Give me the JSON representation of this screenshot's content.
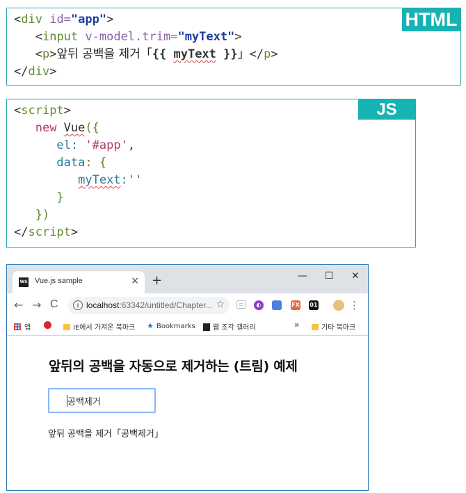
{
  "html_panel": {
    "badge": "HTML",
    "line1": {
      "open": "<",
      "tag": "div",
      "attr": " id=",
      "value": "\"app\"",
      "close": ">"
    },
    "line2": {
      "open": "<",
      "tag": "input",
      "attr": " v-model.trim=",
      "value": "\"myText\"",
      "close": ">"
    },
    "line3": {
      "open": "<",
      "tag": "p",
      "close": ">",
      "text_before": "앞뒤 공백을 제거「",
      "mustache_open": "{{ ",
      "var": "myText",
      "mustache_close": " }}",
      "text_after": "」",
      "end_open": "</",
      "end_tag": "p",
      "end_close": ">"
    },
    "line4": {
      "open": "</",
      "tag": "div",
      "close": ">"
    }
  },
  "js_panel": {
    "badge": "JS",
    "line1": {
      "open": "<",
      "tag": "script",
      "close": ">"
    },
    "line2": {
      "kw": "new ",
      "name": "Vue",
      "rest": "({"
    },
    "line3": {
      "prop": "el",
      "colon": ": ",
      "value": "'#app'",
      "comma": ","
    },
    "line4": {
      "prop": "data",
      "rest": ": {"
    },
    "line5": {
      "prop": "myText",
      "colon": ":",
      "value": "''"
    },
    "line6": {
      "brace": "}"
    },
    "line7": {
      "brace": "})"
    },
    "line8": {
      "open": "</",
      "tag": "script",
      "close": ">"
    }
  },
  "browser": {
    "tab_title": "Vue.js sample",
    "favicon_text": "WS",
    "tab_close": "×",
    "new_tab": "+",
    "window_controls": {
      "minimize": "—",
      "maximize": "☐",
      "close": "✕"
    },
    "nav": {
      "back": "←",
      "forward": "→",
      "reload": "C"
    },
    "url_host": "localhost",
    "url_rest": ":63342/untitled/Chapter...",
    "info_icon": "i",
    "star": "☆",
    "menu": "⋮",
    "extensions": [
      {
        "icon": "screen-capture-icon",
        "text": "▭",
        "color": "#9aa0a6"
      },
      {
        "icon": "translate-icon",
        "text": "◐",
        "color": "#8e3ccf"
      },
      {
        "icon": "bookmark-blue-icon",
        "text": "",
        "color": "#4a7fe0"
      },
      {
        "icon": "fx-icon",
        "text": "FX",
        "color": "#e8643a"
      },
      {
        "icon": "01-icon",
        "text": "01",
        "color": "#111111"
      },
      {
        "icon": "profile-avatar-icon",
        "text": "",
        "color": "#e8c27a"
      }
    ],
    "bookmarks": {
      "apps": "앱",
      "ie_import": "IE에서 가져온 북마크",
      "bookmarks": "Bookmarks",
      "web_slices": "웹 조각 갤러리",
      "overflow": "»",
      "other": "기타 북마크"
    },
    "page": {
      "heading": "앞뒤의 공백을 자동으로 제거하는 (트림) 예제",
      "input_value": "공백제거",
      "result_text": "앞뒤 공백을 제거「공백제거」"
    }
  }
}
